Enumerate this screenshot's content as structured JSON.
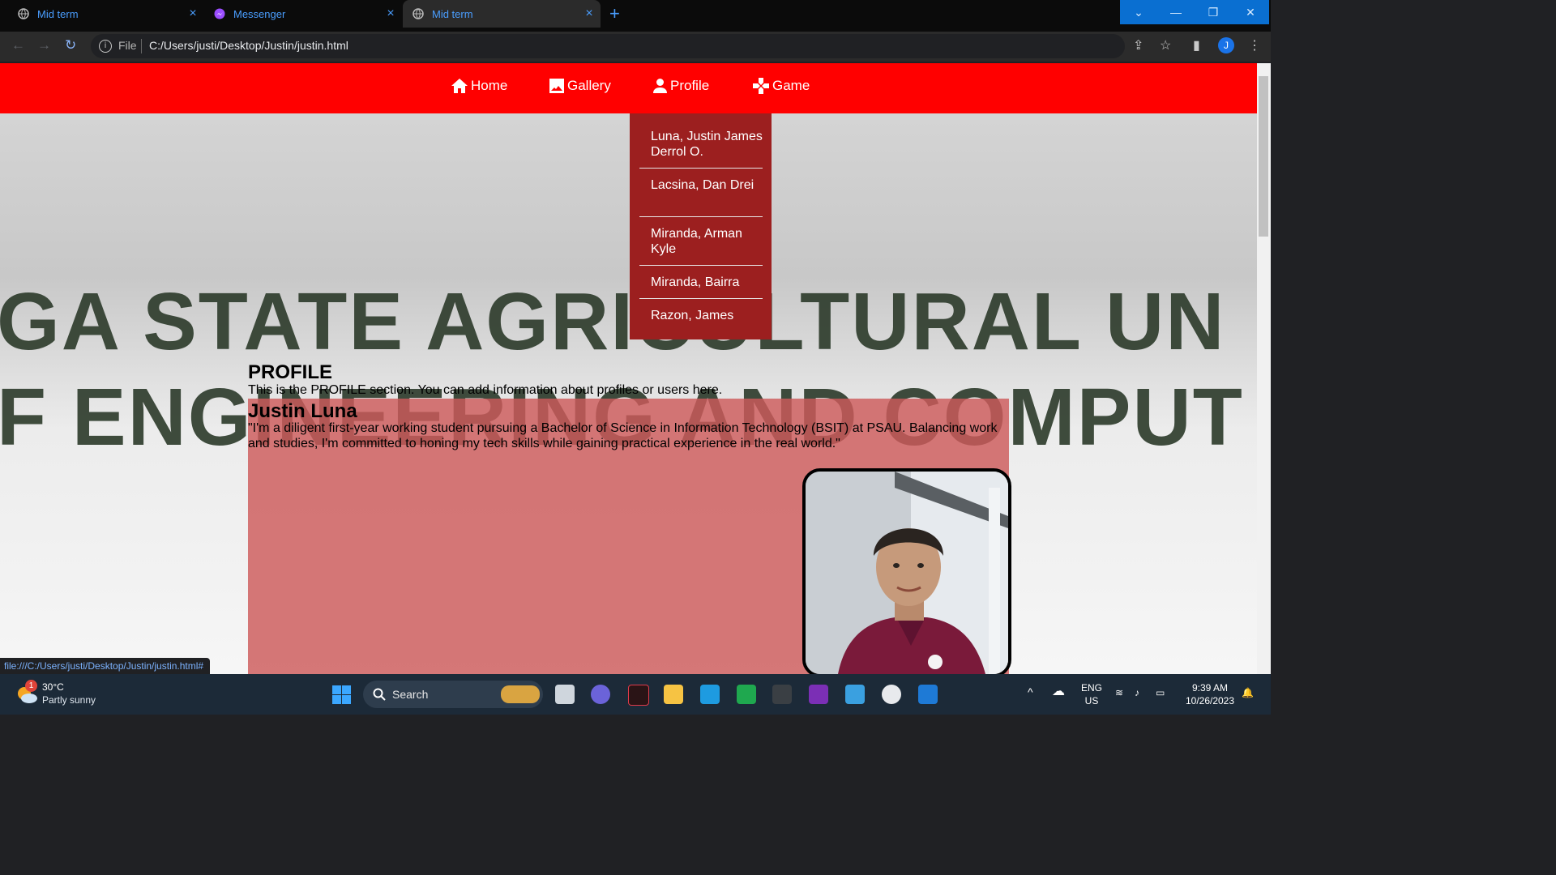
{
  "browser": {
    "tabs": [
      {
        "label": "Mid term",
        "active": false
      },
      {
        "label": "Messenger",
        "active": false
      },
      {
        "label": "Mid term",
        "active": true
      }
    ],
    "address": {
      "scheme_label": "File",
      "url": "C:/Users/justi/Desktop/Justin/justin.html"
    },
    "profile_initial": "J",
    "status_url": "file:///C:/Users/justi/Desktop/Justin/justin.html#"
  },
  "page": {
    "background_text": [
      "GA STATE AGRICULTURAL UN",
      "F ENGINEERING AND COMPUT"
    ],
    "nav": [
      {
        "label": "Home",
        "icon": "home-icon"
      },
      {
        "label": "Gallery",
        "icon": "image-icon"
      },
      {
        "label": "Profile",
        "icon": "person-icon"
      },
      {
        "label": "Game",
        "icon": "gamepad-icon"
      }
    ],
    "profile_dropdown": [
      "Luna, Justin James Derrol O.",
      "Lacsina, Dan Drei",
      "Miranda, Arman Kyle",
      "Miranda, Bairra",
      "Razon, James"
    ],
    "section": {
      "title": "PROFILE",
      "description": "This is the PROFILE section. You can add information about profiles or users here."
    },
    "profile_card": {
      "name": "Justin Luna",
      "quote": "\"I'm a diligent first-year working student pursuing a Bachelor of Science in Information Technology (BSIT) at PSAU. Balancing work and studies, I'm committed to honing my tech skills while gaining practical experience in the real world.\""
    },
    "colors": {
      "navbar": "#ff0000",
      "dropdown": "#9c1f1f",
      "card": "#cd5a5a"
    }
  },
  "taskbar": {
    "weather": {
      "temp": "30°C",
      "desc": "Partly sunny",
      "badge": "1"
    },
    "search_label": "Search",
    "lang": [
      "ENG",
      "US"
    ],
    "time": "9:39 AM",
    "date": "10/26/2023"
  }
}
